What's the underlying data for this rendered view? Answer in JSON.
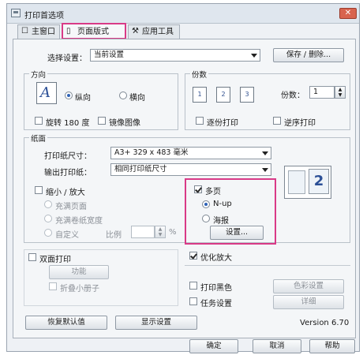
{
  "window": {
    "title": "打印首选项",
    "close_label": "✕"
  },
  "tabs": [
    {
      "label": "主窗口",
      "icon": "printer-icon"
    },
    {
      "label": "页面版式",
      "icon": "page-icon"
    },
    {
      "label": "应用工具",
      "icon": "tools-icon"
    }
  ],
  "settings": {
    "label": "选择设置：",
    "value": "当前设置",
    "save_delete": "保存 / 删除..."
  },
  "orientation": {
    "title": "方向",
    "portrait": "纵向",
    "landscape": "横向",
    "selected": "纵向",
    "rotate180": "旋转 180 度",
    "mirror": "镜像图像"
  },
  "copies": {
    "title": "份数",
    "label": "份数：",
    "value": "1",
    "collate": "逐份打印",
    "reverse": "逆序打印",
    "collate_icon_labels": [
      "1",
      "2",
      "3"
    ]
  },
  "paper": {
    "title": "纸面",
    "size_label": "打印纸尺寸：",
    "size_value": "A3+ 329 x 483 毫米",
    "output_label": "输出打印纸：",
    "output_value": "相同打印纸尺寸",
    "reduce_enlarge": "缩小 / 放大",
    "fit_page": "充满页面",
    "fit_roll": "充满卷纸宽度",
    "custom": "自定义",
    "scale_label": "比例",
    "percent": "%",
    "multipage": "多页",
    "nup": "N-up",
    "poster": "海报",
    "settings_btn": "设置...",
    "preview_number": "2"
  },
  "duplex": {
    "label": "双面打印",
    "function_btn": "功能",
    "booklet": "折叠小册子"
  },
  "options": {
    "optimize": "优化放大",
    "print_black": "打印黑色",
    "color_settings": "色彩设置",
    "job_settings": "任务设置",
    "details": "详细"
  },
  "footer": {
    "restore": "恢复默认值",
    "show_settings": "显示设置",
    "version": "Version 6.70",
    "ok": "确定",
    "cancel": "取消",
    "help": "帮助"
  },
  "colors": {
    "highlight": "#d93a87",
    "accent": "#2e62b6"
  }
}
